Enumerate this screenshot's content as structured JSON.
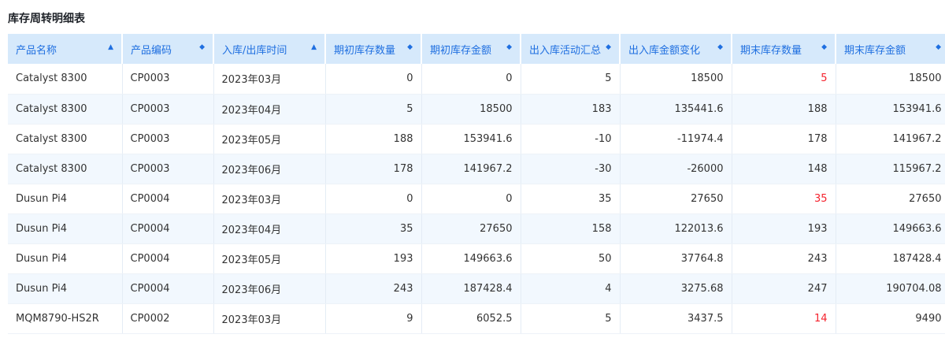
{
  "title": "库存周转明细表",
  "colors": {
    "header_bg": "#d6e9fb",
    "header_text": "#1f6fe0",
    "highlight": "#f5222d"
  },
  "columns": [
    {
      "label": "产品名称",
      "sort_icon": "▲",
      "align": "left"
    },
    {
      "label": "产品编码",
      "sort_icon": "◆",
      "align": "left"
    },
    {
      "label": "入库/出库时间",
      "sort_icon": "▲",
      "align": "left"
    },
    {
      "label": "期初库存数量",
      "sort_icon": "◆",
      "align": "right"
    },
    {
      "label": "期初库存金额",
      "sort_icon": "◆",
      "align": "right"
    },
    {
      "label": "出入库活动汇总",
      "sort_icon": "◆",
      "align": "right"
    },
    {
      "label": "出入库金额变化",
      "sort_icon": "◆",
      "align": "right"
    },
    {
      "label": "期末库存数量",
      "sort_icon": "◆",
      "align": "right"
    },
    {
      "label": "期末库存金额",
      "sort_icon": "◆",
      "align": "right"
    }
  ],
  "rows": [
    {
      "cells": [
        "Catalyst 8300",
        "CP0003",
        "2023年03月",
        "0",
        "0",
        "5",
        "18500",
        "5",
        "18500"
      ],
      "highlight": true
    },
    {
      "cells": [
        "Catalyst 8300",
        "CP0003",
        "2023年04月",
        "5",
        "18500",
        "183",
        "135441.6",
        "188",
        "153941.6"
      ],
      "highlight": false
    },
    {
      "cells": [
        "Catalyst 8300",
        "CP0003",
        "2023年05月",
        "188",
        "153941.6",
        "-10",
        "-11974.4",
        "178",
        "141967.2"
      ],
      "highlight": false
    },
    {
      "cells": [
        "Catalyst 8300",
        "CP0003",
        "2023年06月",
        "178",
        "141967.2",
        "-30",
        "-26000",
        "148",
        "115967.2"
      ],
      "highlight": false
    },
    {
      "cells": [
        "Dusun Pi4",
        "CP0004",
        "2023年03月",
        "0",
        "0",
        "35",
        "27650",
        "35",
        "27650"
      ],
      "highlight": true
    },
    {
      "cells": [
        "Dusun Pi4",
        "CP0004",
        "2023年04月",
        "35",
        "27650",
        "158",
        "122013.6",
        "193",
        "149663.6"
      ],
      "highlight": false
    },
    {
      "cells": [
        "Dusun Pi4",
        "CP0004",
        "2023年05月",
        "193",
        "149663.6",
        "50",
        "37764.8",
        "243",
        "187428.4"
      ],
      "highlight": false
    },
    {
      "cells": [
        "Dusun Pi4",
        "CP0004",
        "2023年06月",
        "243",
        "187428.4",
        "4",
        "3275.68",
        "247",
        "190704.08"
      ],
      "highlight": false
    },
    {
      "cells": [
        "MQM8790-HS2R",
        "CP0002",
        "2023年03月",
        "9",
        "6052.5",
        "5",
        "3437.5",
        "14",
        "9490"
      ],
      "highlight": true
    }
  ]
}
